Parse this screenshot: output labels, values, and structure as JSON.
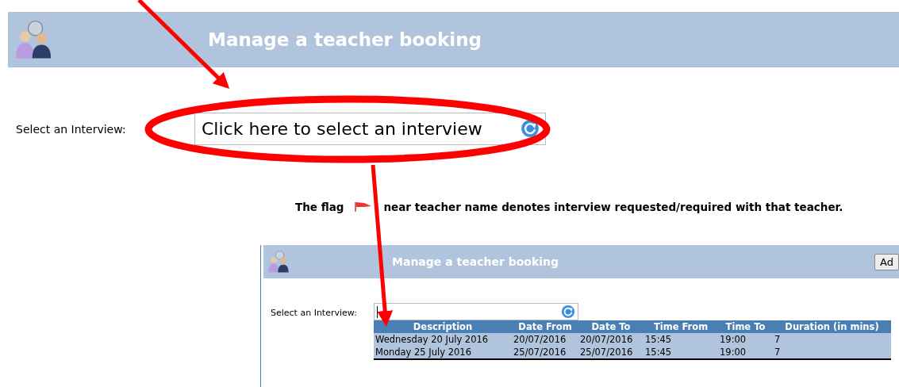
{
  "header": {
    "title": "Manage a teacher booking"
  },
  "interview_field": {
    "label": "Select an Interview:",
    "placeholder": "Click here to select an interview"
  },
  "flag_note": {
    "before": "The flag",
    "after": "near teacher name denotes interview requested/required with that teacher."
  },
  "inset": {
    "title": "Manage a teacher booking",
    "button": "Ad",
    "label": "Select an Interview:",
    "table": {
      "columns": [
        "Description",
        "Date From",
        "Date To",
        "Time From",
        "Time To",
        "Duration (in mins)"
      ],
      "rows": [
        [
          "Wednesday 20 July 2016",
          "20/07/2016",
          "20/07/2016",
          "15:45",
          "19:00",
          "7"
        ],
        [
          "Monday 25 July 2016",
          "25/07/2016",
          "25/07/2016",
          "15:45",
          "19:00",
          "7"
        ]
      ]
    }
  }
}
